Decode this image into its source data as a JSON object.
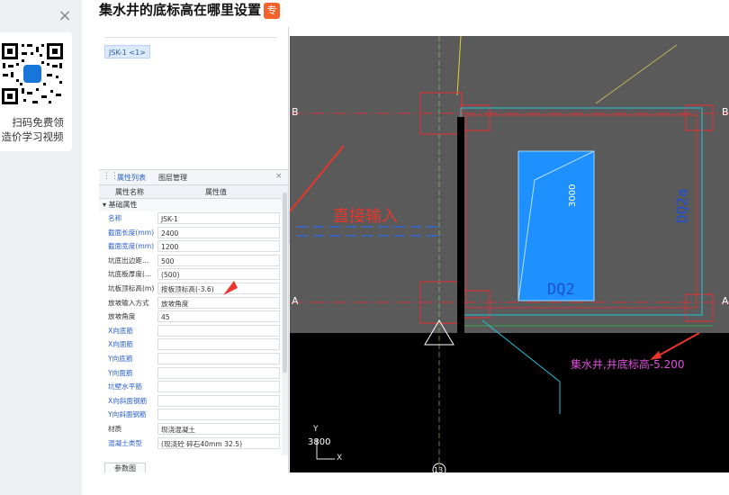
{
  "question": {
    "title": "集水井的底标高在哪里设置",
    "badge": "专"
  },
  "promo": {
    "close_glyph": "×",
    "line1": "扫码免费领",
    "line2": "造价学习视频",
    "qr_center_letter": "G"
  },
  "software": {
    "tree_tag": "JSK-1 <1>",
    "panel_tabs": [
      "属性列表",
      "图层管理"
    ],
    "panel_close": "×",
    "columns": [
      "属性名称",
      "属性值"
    ],
    "section": "基础属性",
    "properties": [
      {
        "name": "名称",
        "value": "JSK-1",
        "color": "blue"
      },
      {
        "name": "截面长度(mm)",
        "value": "2400",
        "color": "blue"
      },
      {
        "name": "截面宽度(mm)",
        "value": "1200",
        "color": "blue"
      },
      {
        "name": "坑底出边距...",
        "value": "500",
        "color": "dark"
      },
      {
        "name": "坑底板厚度(...",
        "value": "(500)",
        "color": "dark"
      },
      {
        "name": "坑板顶标高(m)",
        "value": "按板顶标高(-3.6)",
        "color": "dark"
      },
      {
        "name": "放坡输入方式",
        "value": "放坡角度",
        "color": "dark"
      },
      {
        "name": "放坡角度",
        "value": "45",
        "color": "dark"
      },
      {
        "name": "X向底筋",
        "value": "",
        "color": "blue"
      },
      {
        "name": "X向面筋",
        "value": "",
        "color": "blue"
      },
      {
        "name": "Y向底筋",
        "value": "",
        "color": "blue"
      },
      {
        "name": "Y向面筋",
        "value": "",
        "color": "blue"
      },
      {
        "name": "坑壁水平筋",
        "value": "",
        "color": "blue"
      },
      {
        "name": "X向斜面钢筋",
        "value": "",
        "color": "blue"
      },
      {
        "name": "Y向斜面钢筋",
        "value": "",
        "color": "blue"
      },
      {
        "name": "材质",
        "value": "现浇混凝土",
        "color": "dark"
      },
      {
        "name": "混凝土类型",
        "value": "(现浇砼 碎石40mm 32.5)",
        "color": "blue"
      }
    ],
    "param_button": "参数图",
    "splitter_glyph": "‹"
  },
  "cad": {
    "annotation_direct": "直接输入",
    "axis_b": "B",
    "axis_a": "A",
    "dim_3000": "3000",
    "label_dq2": "DQ2",
    "label_dq2a": "DQ2a",
    "note": "集水井,井底标高-5.200",
    "coord_readout": "3800",
    "axis_13": "13",
    "ucs_y": "Y",
    "ucs_x": "X",
    "colors": {
      "annotation_red": "#e8362d",
      "pit_fill": "#1e90ff",
      "grid_red": "#d4343a",
      "wall_cyan": "#21c4d8",
      "note_magenta": "#e34ee0"
    }
  }
}
